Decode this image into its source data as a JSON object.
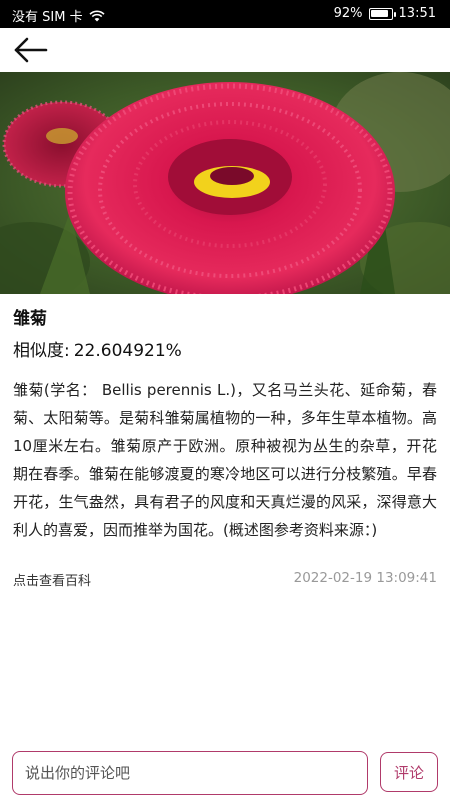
{
  "status_bar": {
    "carrier": "没有 SIM 卡",
    "battery_percent": "92%",
    "battery_level": 0.92,
    "time": "13:51"
  },
  "nav": {
    "back_icon": "arrow-left-icon"
  },
  "flower": {
    "name": "雏菊",
    "similarity_label": "相似度:",
    "similarity_value": "22.604921%",
    "description": "雏菊(学名： Bellis perennis L.)，又名马兰头花、延命菊，春菊、太阳菊等。是菊科雏菊属植物的一种，多年生草本植物。高10厘米左右。雏菊原产于欧洲。原种被视为丛生的杂草，开花期在春季。雏菊在能够渡夏的寒冷地区可以进行分枝繁殖。早春开花，生气盎然，具有君子的风度和天真烂漫的风采，深得意大利人的喜爱，因而推举为国花。(概述图参考资料来源：)",
    "wiki_link": "点击查看百科",
    "timestamp": "2022-02-19 13:09:41"
  },
  "comment": {
    "placeholder": "说出你的评论吧",
    "submit_label": "评论"
  },
  "colors": {
    "accent": "#b03a6a",
    "status_bar_bg": "#000000",
    "timestamp": "#999999"
  }
}
